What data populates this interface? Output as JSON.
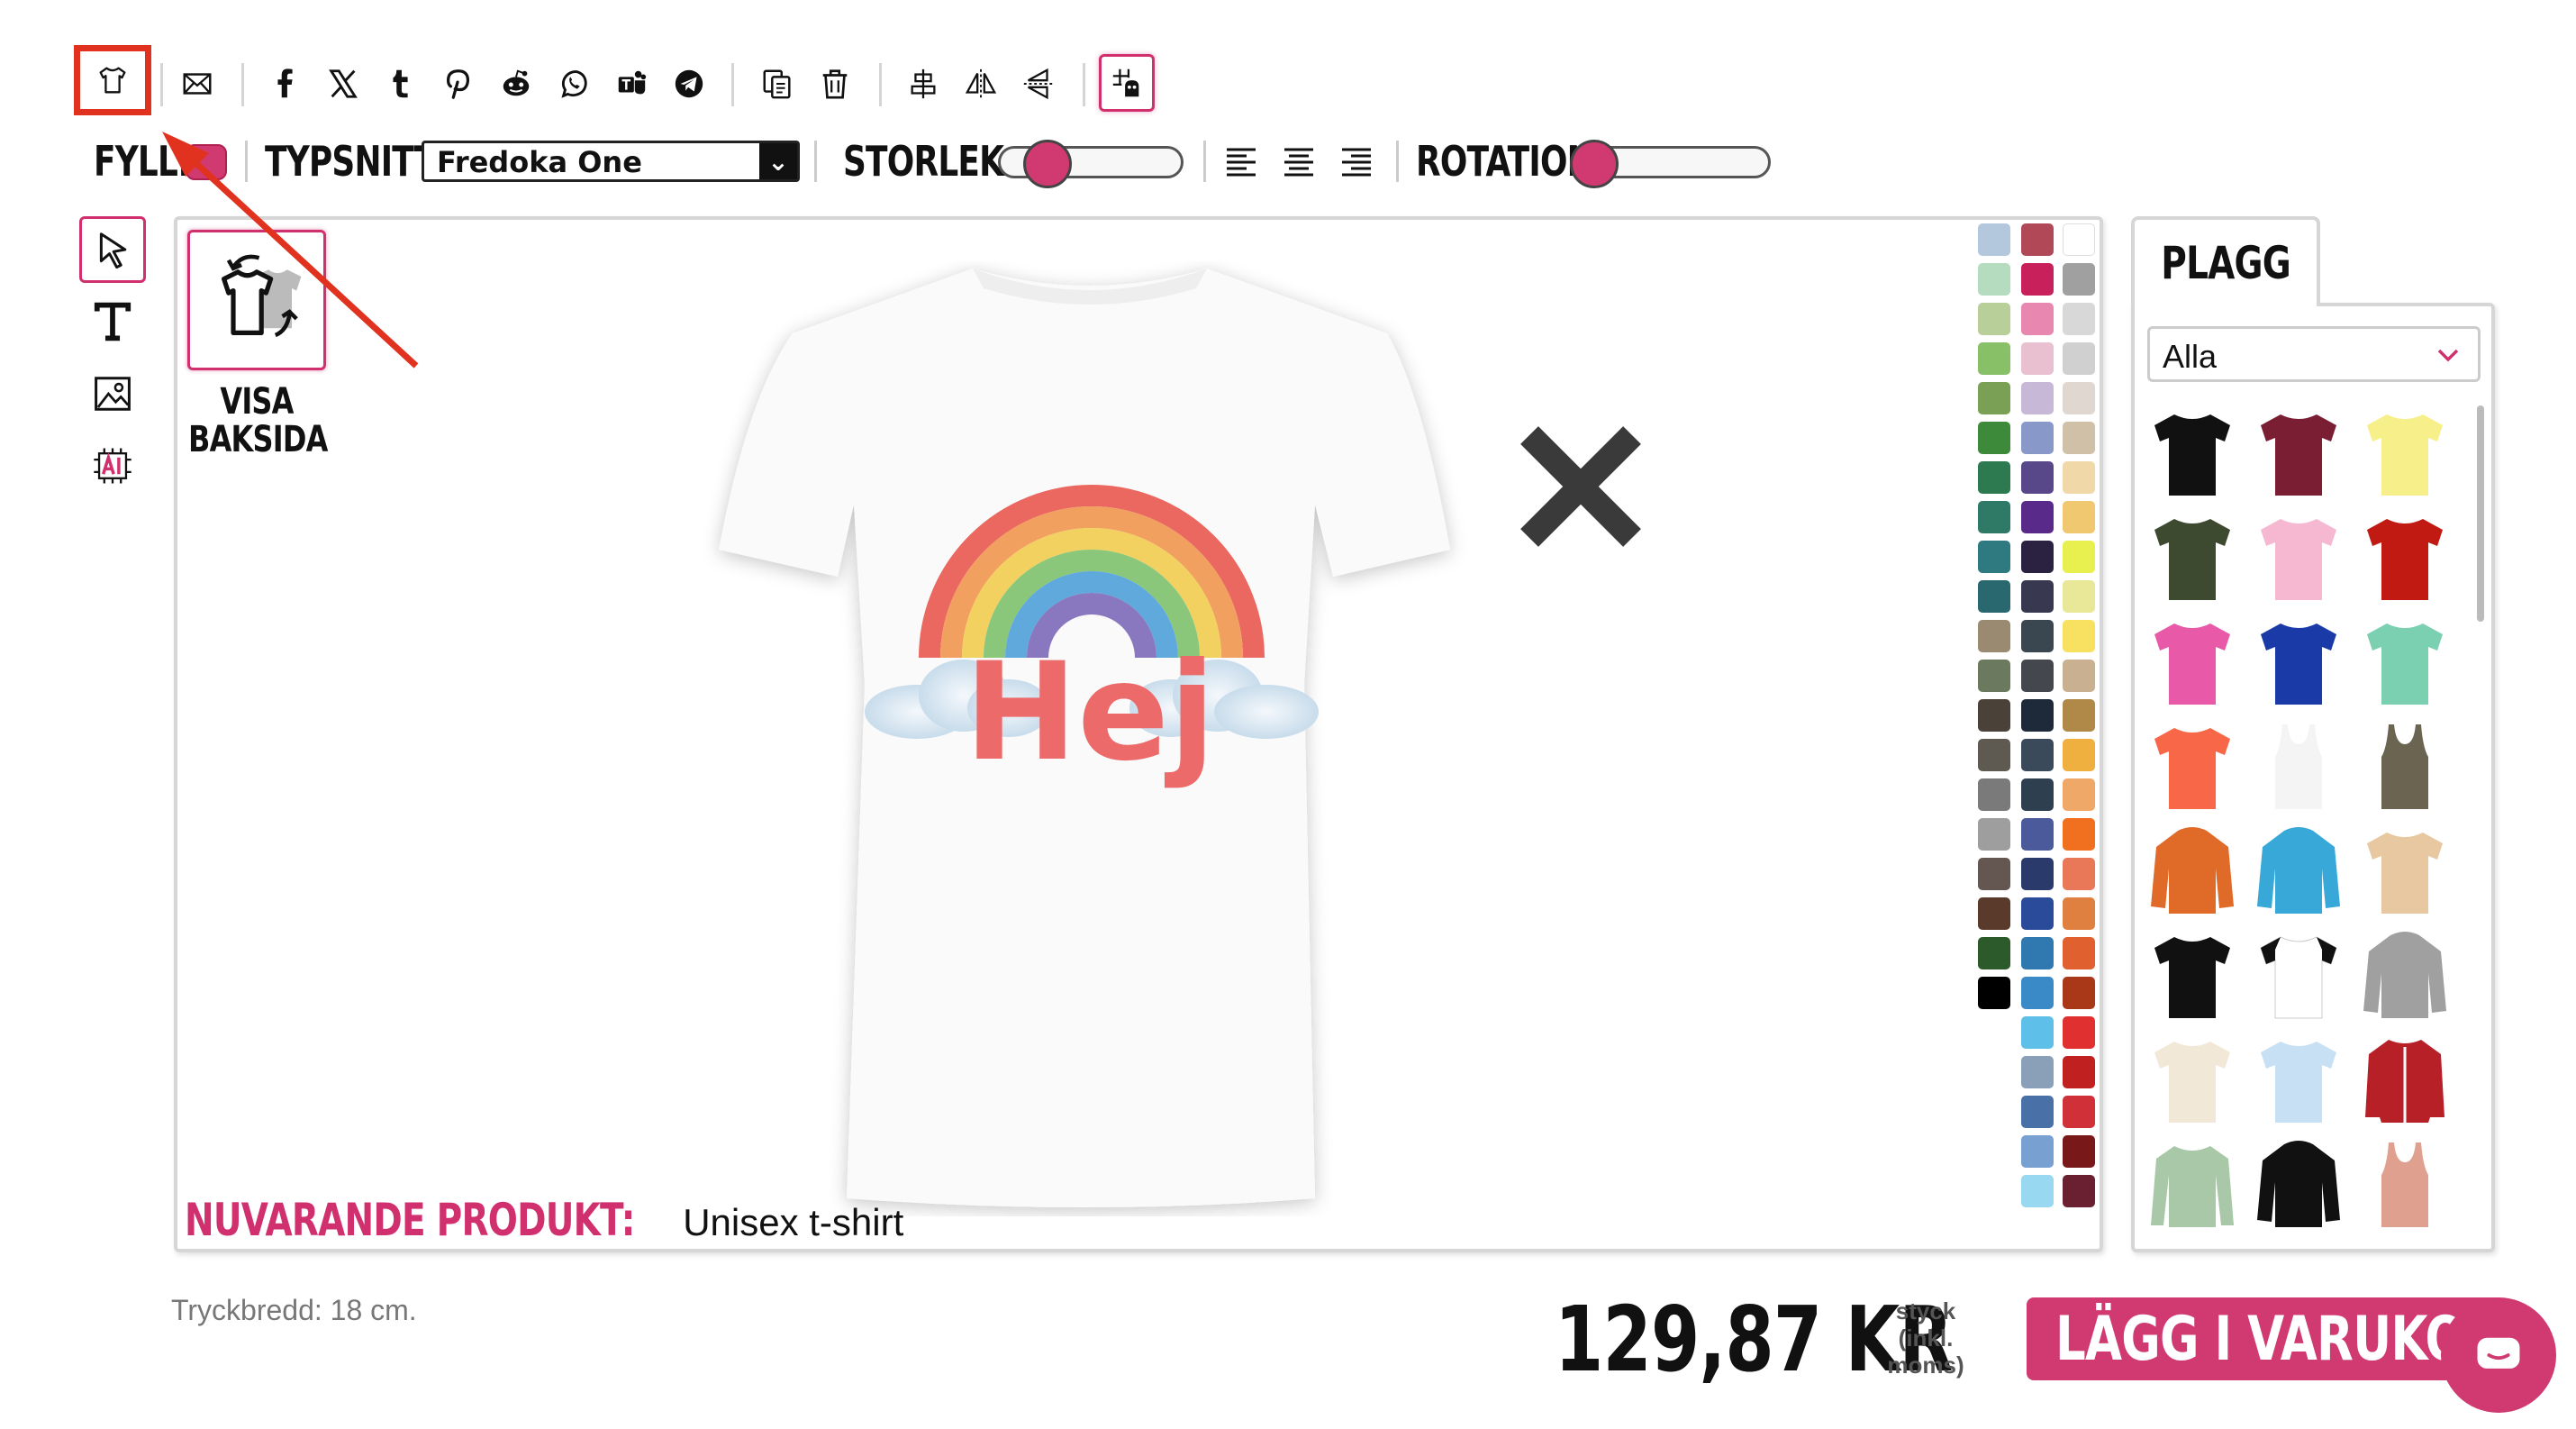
{
  "toolbar": {
    "items": [
      "tshirt-icon",
      "mail-icon",
      "facebook-icon",
      "x-icon",
      "tumblr-icon",
      "pinterest-icon",
      "reddit-icon",
      "whatsapp-icon",
      "teams-icon",
      "telegram-icon",
      "duplicate-icon",
      "trash-icon",
      "align-center-icon",
      "flip-horizontal-icon",
      "flip-vertical-icon",
      "grid-snap-icon"
    ]
  },
  "row2": {
    "fill_label": "FYLL:",
    "fill_color": "#d03a70",
    "font_label": "TYPSNITT:",
    "font_value": "Fredoka One",
    "size_label": "STORLEK:",
    "size_value": 0.2,
    "rotation_label": "ROTATION:",
    "rotation_value": 0.0
  },
  "left_tools": [
    "pointer-icon",
    "text-icon",
    "image-icon",
    "ai-icon"
  ],
  "canvas": {
    "back_label_1": "VISA",
    "back_label_2": "BAKSIDA",
    "design_text": "Hej",
    "current_product_label": "NUVARANDE PRODUKT:",
    "current_product_value": "Unisex t-shirt"
  },
  "palette": {
    "col1": [
      "#b3c8dc",
      "#b6dcc0",
      "#b9cf9a",
      "#88c068",
      "#7aa055",
      "#3c8a3a",
      "#2e7a50",
      "#2e7a66",
      "#2e7a80",
      "#2a6870",
      "#9a8a72",
      "#6b7a5e",
      "#4a4238",
      "#5e5a52",
      "#7a7a7a",
      "#9e9e9e",
      "#645650",
      "#5a3a2a",
      "#2d5a2a",
      "#000000"
    ],
    "col2": [
      "#b04858",
      "#c8205a",
      "#e888b0",
      "#e8c0d0",
      "#c8b8d8",
      "#8898c8",
      "#58488a",
      "#5a2a8a",
      "#2a2240",
      "#383850",
      "#3a4650",
      "#44484e",
      "#1e2a3a",
      "#3a4a5a",
      "#2e4050",
      "#4a5a9a",
      "#2a3a6a",
      "#2a4a9a",
      "#3078b0",
      "#3a8ac8",
      "#5ec0e8",
      "#8aa0b8",
      "#4a70a8",
      "#78a0d0",
      "#98d8f0"
    ],
    "col3": [
      "#ffffff",
      "#a0a0a0",
      "#d8d8d8",
      "#d0d0d0",
      "#e0d8d0",
      "#d0c0a8",
      "#f0d8a8",
      "#f0c870",
      "#e8f050",
      "#e8e898",
      "#f8e060",
      "#c8b090",
      "#b08848",
      "#f0b040",
      "#f0a868",
      "#f07020",
      "#e87858",
      "#e08040",
      "#e06030",
      "#a83818",
      "#e03030",
      "#c02020",
      "#d03038",
      "#781818",
      "#6a2030"
    ]
  },
  "plagg": {
    "tab_label": "PLAGG",
    "filter_value": "Alla",
    "garments": [
      {
        "type": "tshirt",
        "color": "#111111"
      },
      {
        "type": "tshirt",
        "color": "#7a1e34"
      },
      {
        "type": "tshirt",
        "color": "#f6ef8a"
      },
      {
        "type": "tshirt",
        "color": "#3e4a30"
      },
      {
        "type": "tshirt",
        "color": "#f6b8d0"
      },
      {
        "type": "tshirt",
        "color": "#c01a12"
      },
      {
        "type": "tshirt",
        "color": "#e85aa8"
      },
      {
        "type": "tshirt",
        "color": "#1a3aa8"
      },
      {
        "type": "tshirt",
        "color": "#7ad0b0"
      },
      {
        "type": "tshirt",
        "color": "#f86848"
      },
      {
        "type": "tank",
        "color": "#f4f4f4"
      },
      {
        "type": "tank",
        "color": "#6a6450"
      },
      {
        "type": "hoodie",
        "color": "#e06a28"
      },
      {
        "type": "hoodie",
        "color": "#38a8d8"
      },
      {
        "type": "tshirt",
        "color": "#e8c8a0"
      },
      {
        "type": "tshirt",
        "color": "#111111"
      },
      {
        "type": "raglan",
        "color": "#ffffff"
      },
      {
        "type": "hoodie",
        "color": "#a0a0a0"
      },
      {
        "type": "tshirt",
        "color": "#f2e8d8"
      },
      {
        "type": "tshirt",
        "color": "#c8e0f4"
      },
      {
        "type": "jacket",
        "color": "#b82028"
      },
      {
        "type": "longsleeve",
        "color": "#a8c8a8"
      },
      {
        "type": "hoodie",
        "color": "#111111"
      },
      {
        "type": "tank",
        "color": "#e0a090"
      }
    ]
  },
  "footer": {
    "print_width": "Tryckbredd: 18 cm.",
    "price": "129,87 KR",
    "unit_1": "styck",
    "unit_2": "(inkl.",
    "unit_3": "moms)",
    "cart_button": "LÄGG I VARUKORGEN"
  },
  "colors": {
    "accent": "#d03a70",
    "annotation": "#e0321e"
  }
}
